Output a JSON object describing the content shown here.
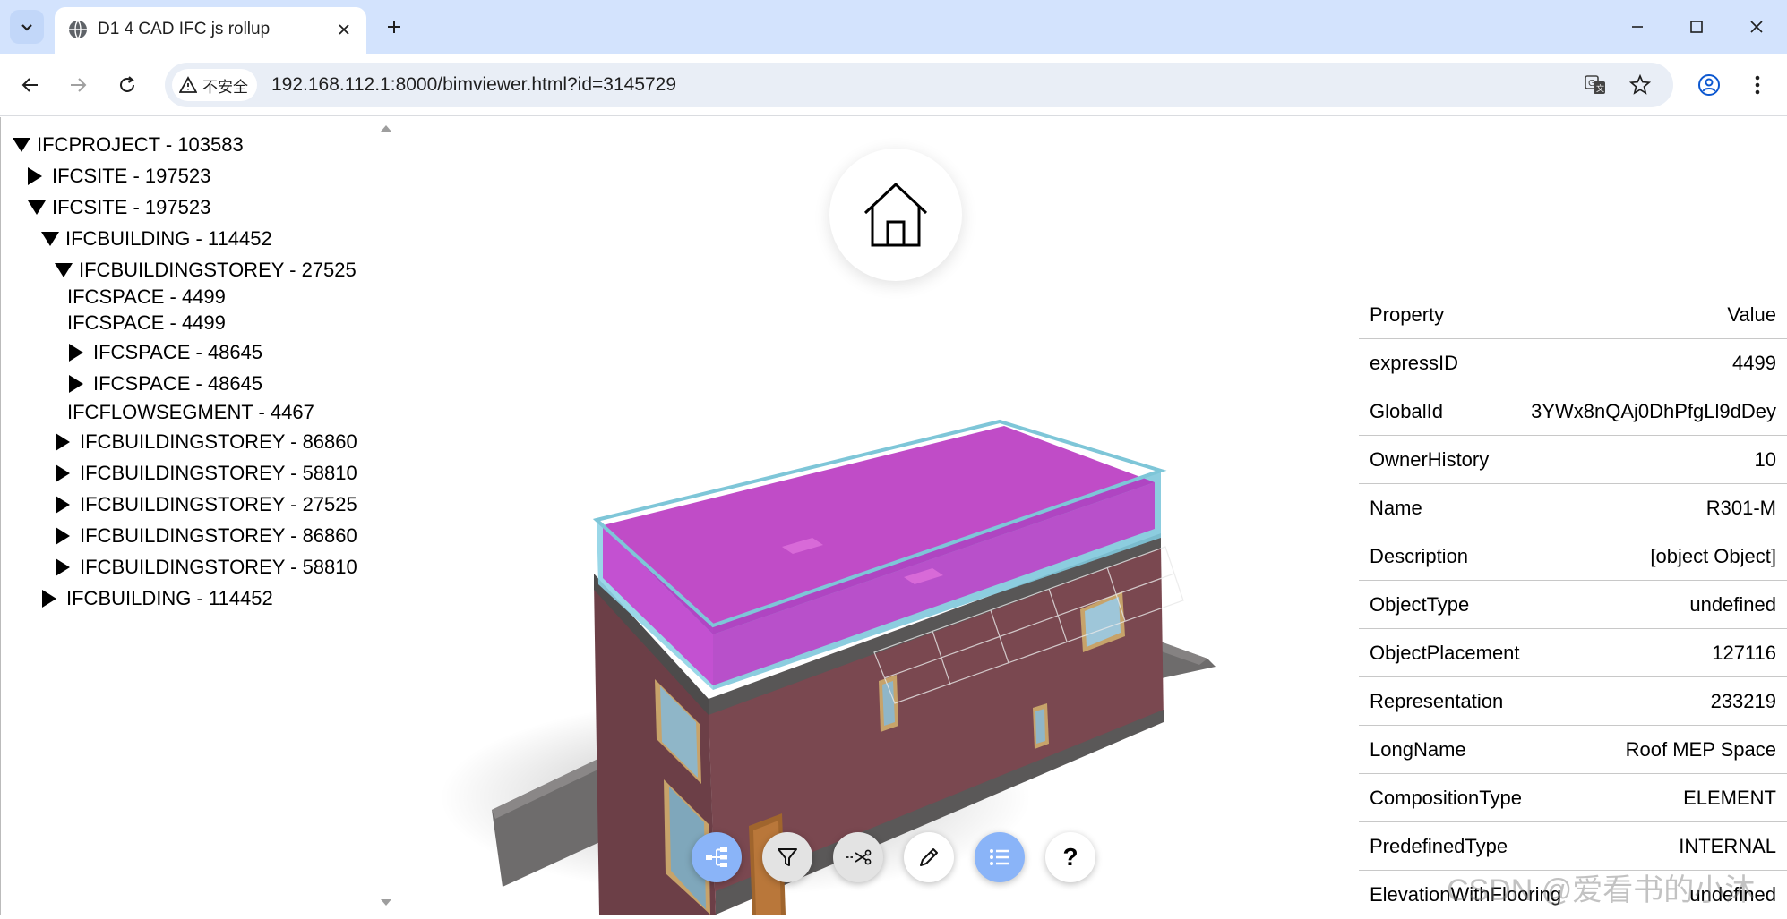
{
  "browser": {
    "tab_title": "D1 4 CAD IFC js rollup",
    "security_label": "不安全",
    "url": "192.168.112.1:8000/bimviewer.html?id=3145729"
  },
  "tree": [
    {
      "label": "IFCPROJECT - 103583",
      "caret": "down"
    },
    {
      "label": "IFCSITE - 197523",
      "caret": "right"
    },
    {
      "label": "IFCSITE - 197523",
      "caret": "down"
    },
    {
      "label": "IFCBUILDING - 114452",
      "caret": "down"
    },
    {
      "label": "IFCBUILDINGSTOREY - 27525",
      "caret": "down"
    },
    {
      "label": "IFCSPACE - 4499",
      "caret": "none"
    },
    {
      "label": "IFCSPACE - 4499",
      "caret": "none"
    },
    {
      "label": "IFCSPACE - 48645",
      "caret": "right"
    },
    {
      "label": "IFCSPACE - 48645",
      "caret": "right"
    },
    {
      "label": "IFCFLOWSEGMENT - 4467",
      "caret": "none"
    },
    {
      "label": "IFCBUILDINGSTOREY - 86860",
      "caret": "right"
    },
    {
      "label": "IFCBUILDINGSTOREY - 58810",
      "caret": "right"
    },
    {
      "label": "IFCBUILDINGSTOREY - 27525",
      "caret": "right"
    },
    {
      "label": "IFCBUILDINGSTOREY - 86860",
      "caret": "right"
    },
    {
      "label": "IFCBUILDINGSTOREY - 58810",
      "caret": "right"
    },
    {
      "label": "IFCBUILDING - 114452",
      "caret": "right"
    }
  ],
  "properties": {
    "header_key": "Property",
    "header_value": "Value",
    "rows": [
      {
        "key": "expressID",
        "value": "4499"
      },
      {
        "key": "GlobalId",
        "value": "3YWx8nQAj0DhPfgLl9dDey"
      },
      {
        "key": "OwnerHistory",
        "value": "10"
      },
      {
        "key": "Name",
        "value": "R301-M"
      },
      {
        "key": "Description",
        "value": "[object Object]"
      },
      {
        "key": "ObjectType",
        "value": "undefined"
      },
      {
        "key": "ObjectPlacement",
        "value": "127116"
      },
      {
        "key": "Representation",
        "value": "233219"
      },
      {
        "key": "LongName",
        "value": "Roof MEP Space"
      },
      {
        "key": "CompositionType",
        "value": "ELEMENT"
      },
      {
        "key": "PredefinedType",
        "value": "INTERNAL"
      },
      {
        "key": "ElevationWithFlooring",
        "value": "undefined"
      }
    ]
  },
  "tools": {
    "help_label": "?"
  },
  "watermark": "CSDN @爱看书的小沐",
  "colors": {
    "tabbar": "#d3e3fd",
    "active_tool": "#8ab4f8",
    "selection": "#cc33cc"
  }
}
